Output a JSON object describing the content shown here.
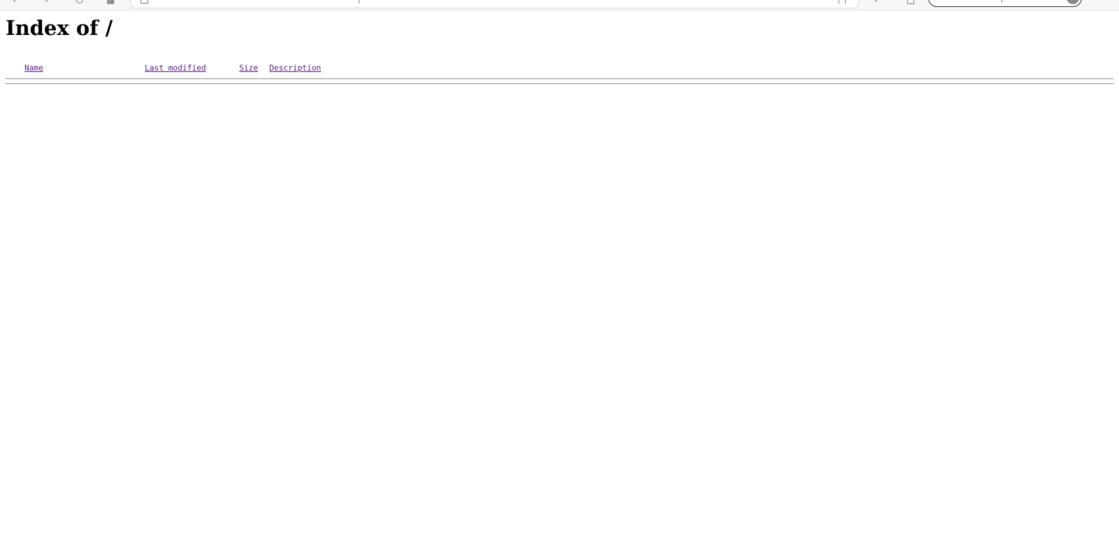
{
  "browser": {
    "back_icon": "back-arrow-icon",
    "forward_icon": "forward-arrow-icon",
    "reload_icon": "reload-icon",
    "tabs_icon": "tabs-icon",
    "reader_icon": "reader-icon",
    "extensions_icon": "extensions-icon",
    "avatar_icon": "user-avatar-icon"
  },
  "page": {
    "title": "Index of /"
  },
  "listing": {
    "headers": {
      "name": "Name",
      "last_modified": "Last modified",
      "size": "Size",
      "description": "Description"
    },
    "rows": []
  },
  "colors": {
    "link_visited": "#551a8b",
    "rule": "#9a9a9a",
    "background": "#ffffff"
  }
}
